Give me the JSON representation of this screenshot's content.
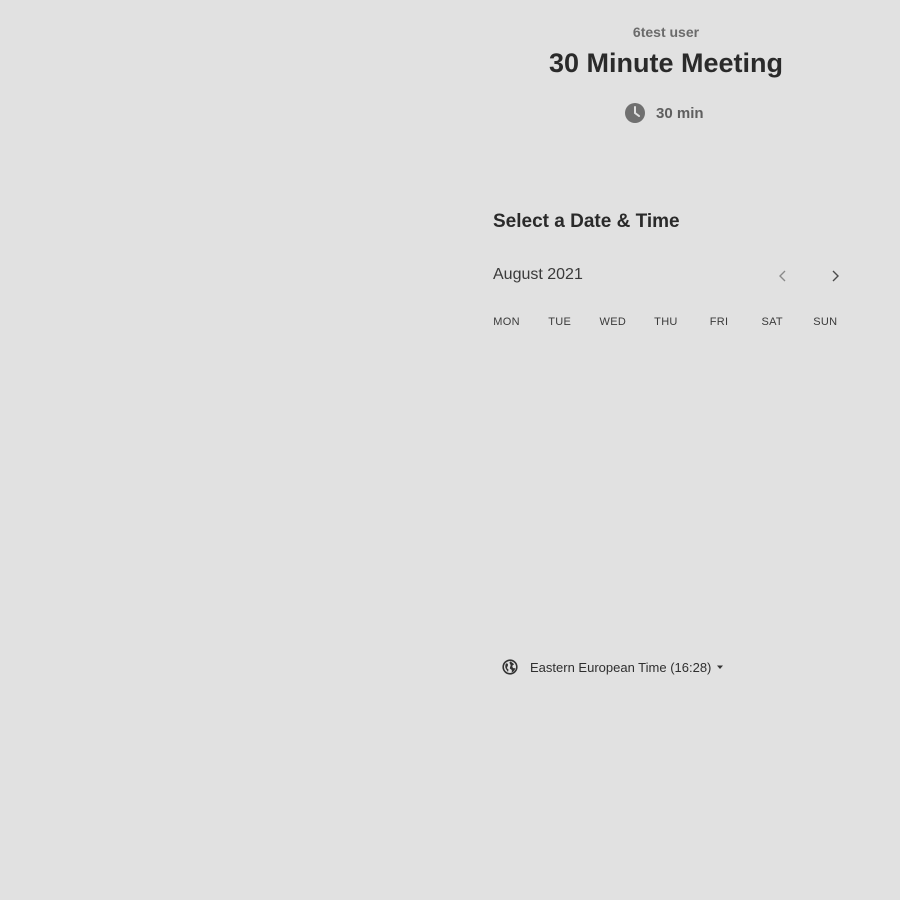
{
  "event": {
    "host_name": "6test user",
    "title": "30 Minute Meeting",
    "duration": "30 min",
    "duration_icon": "clock-icon"
  },
  "calendar": {
    "heading": "Select a Date & Time",
    "month": "August 2021",
    "prev_icon": "chevron-left-icon",
    "next_icon": "chevron-right-icon",
    "weekdays": [
      "MON",
      "TUE",
      "WED",
      "THU",
      "FRI",
      "SAT",
      "SUN"
    ]
  },
  "timezone": {
    "label": "Eastern European Time (16:28)",
    "icon": "globe-icon",
    "caret_icon": "caret-down-icon"
  },
  "colors": {
    "background": "#e1e1e1",
    "text_dark": "#2a2a2a",
    "text_muted": "#6b6b6b"
  }
}
